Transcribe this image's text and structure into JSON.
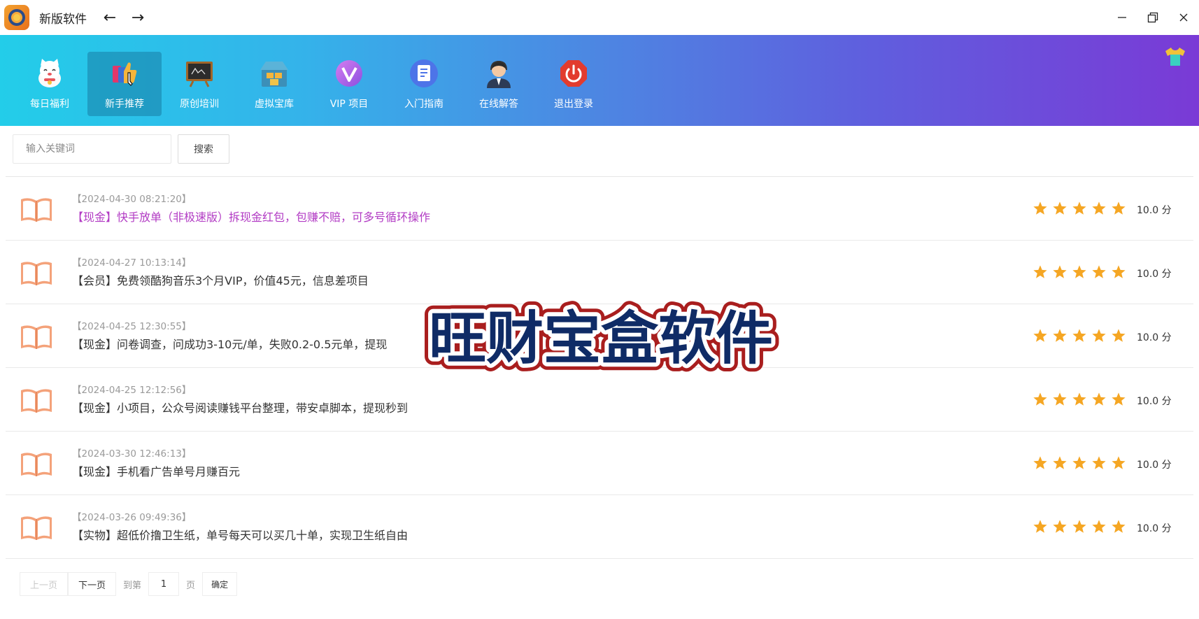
{
  "window": {
    "title": "新版软件",
    "back_icon": "arrow-left-icon",
    "forward_icon": "arrow-right-icon",
    "controls": [
      "minimize-icon",
      "restore-icon",
      "close-icon"
    ]
  },
  "toolbar": {
    "items": [
      {
        "label": "每日福利",
        "icon": "lucky-cat-icon"
      },
      {
        "label": "新手推荐",
        "icon": "thumbs-up-icon",
        "active": true
      },
      {
        "label": "原创培训",
        "icon": "blackboard-icon"
      },
      {
        "label": "虚拟宝库",
        "icon": "treasure-shop-icon"
      },
      {
        "label": "VIP 项目",
        "icon": "vip-icon"
      },
      {
        "label": "入门指南",
        "icon": "guide-document-icon"
      },
      {
        "label": "在线解答",
        "icon": "support-agent-icon"
      },
      {
        "label": "退出登录",
        "icon": "power-icon"
      }
    ],
    "skin_icon": "tshirt-icon"
  },
  "search": {
    "placeholder": "输入关键词",
    "button_label": "搜索"
  },
  "articles": [
    {
      "date": "【2024-04-30 08:21:20】",
      "title": "【现金】快手放单（非极速版）拆现金红包，包赚不赔，可多号循环操作",
      "rating": 5,
      "score": "10.0 分",
      "highlight": true
    },
    {
      "date": "【2024-04-27 10:13:14】",
      "title": "【会员】免费领酷狗音乐3个月VIP，价值45元，信息差项目",
      "rating": 5,
      "score": "10.0 分",
      "highlight": false
    },
    {
      "date": "【2024-04-25 12:30:55】",
      "title": "【现金】问卷调查，问成功3-10元/单，失败0.2-0.5元单，提现",
      "rating": 5,
      "score": "10.0 分",
      "highlight": false
    },
    {
      "date": "【2024-04-25 12:12:56】",
      "title": "【现金】小项目，公众号阅读赚钱平台整理，带安卓脚本，提现秒到",
      "rating": 5,
      "score": "10.0 分",
      "highlight": false
    },
    {
      "date": "【2024-03-30 12:46:13】",
      "title": "【现金】手机看广告单号月赚百元",
      "rating": 5,
      "score": "10.0 分",
      "highlight": false
    },
    {
      "date": "【2024-03-26 09:49:36】",
      "title": "【实物】超低价撸卫生纸，单号每天可以买几十单，实现卫生纸自由",
      "rating": 5,
      "score": "10.0 分",
      "highlight": false
    }
  ],
  "pager": {
    "prev_label": "上一页",
    "next_label": "下一页",
    "goto_label": "到第",
    "page_value": "1",
    "page_suffix": "页",
    "confirm_label": "确定"
  },
  "overlay": {
    "caption": "旺财宝盒软件"
  },
  "colors": {
    "banner_start": "#23cde9",
    "banner_end": "#7a3ad6",
    "highlight_title": "#b23bc4",
    "star": "#f5a623",
    "overlay_fill": "#0f2b66",
    "overlay_stroke": "#a91e1e"
  }
}
